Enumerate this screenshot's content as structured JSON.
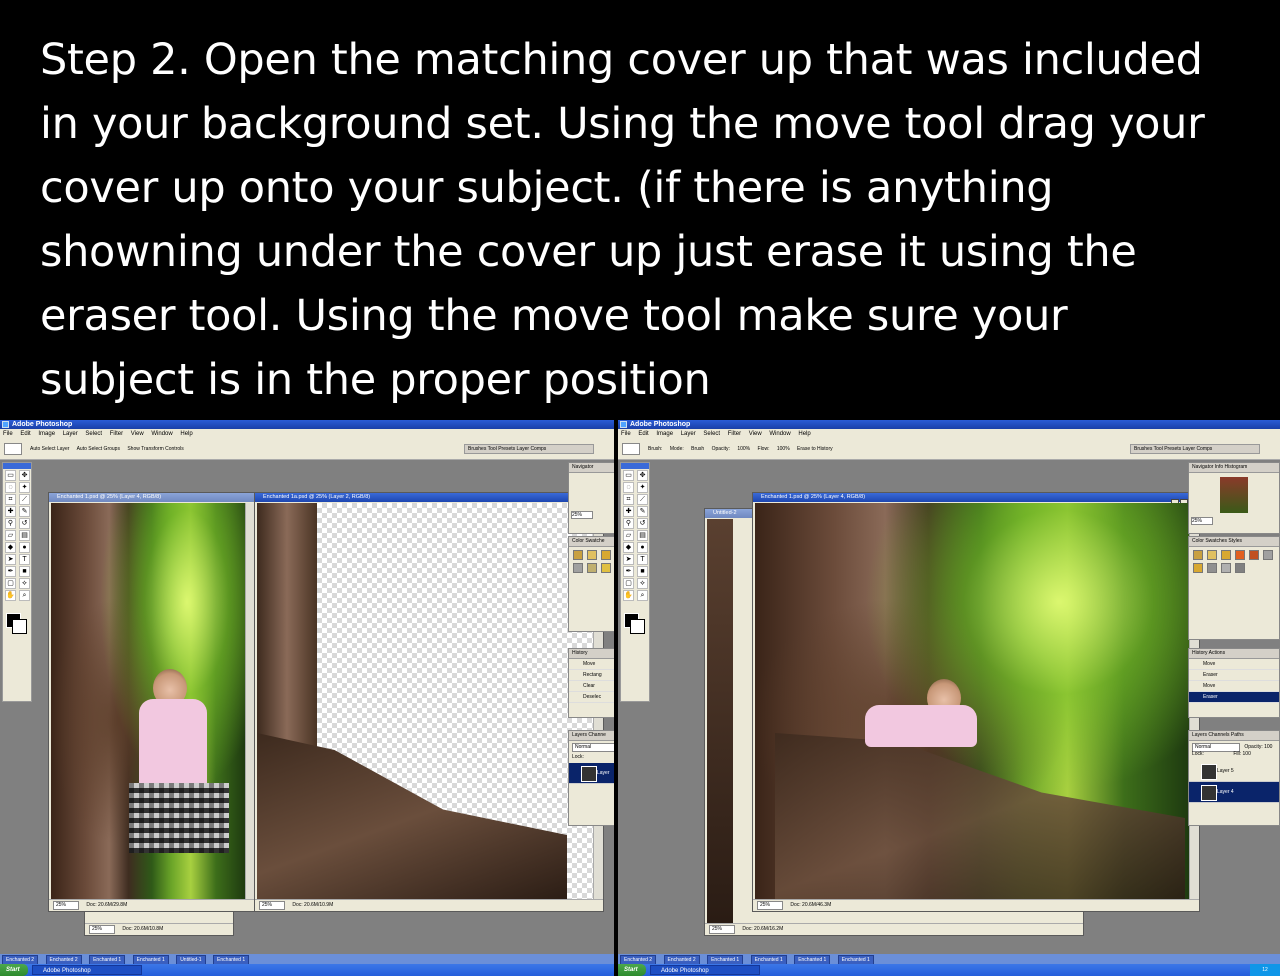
{
  "caption": {
    "lines": [
      "Step 2. Open the matching cover up that was included",
      "in your background set. Using the move tool drag your",
      "cover up onto your subject. (if there is anything",
      "showning under the cover up just erase it using the",
      "eraser tool. Using the move tool make sure your",
      "subject is in the proper position"
    ]
  },
  "left": {
    "app_title": "Adobe Photoshop",
    "menu": [
      "File",
      "Edit",
      "Image",
      "Layer",
      "Select",
      "Filter",
      "View",
      "Window",
      "Help"
    ],
    "options": [
      "Auto Select Layer",
      "Auto Select Groups",
      "Show Transform Controls"
    ],
    "dock_tabs": "Brushes  Tool Presets  Layer Comps",
    "doc1": {
      "title": "Enchanted 1.psd @ 25% (Layer 4, RGB/8)",
      "zoom": "25%",
      "doc": "Doc: 20.6M/29.8M"
    },
    "doc2": {
      "title": "Enchanted 1a.psd @ 25% (Layer 2, RGB/8)",
      "zoom": "25%",
      "doc": "Doc: 20.6M/10.9M"
    },
    "doc_back": {
      "zoom": "25%",
      "doc": "Doc: 20.6M/10.8M"
    },
    "navigator": {
      "tab": "Navigator",
      "zoom": "25%"
    },
    "color_tabs": "Color  Swatche",
    "history": {
      "tab": "History",
      "items": [
        "Move",
        "Rectang",
        "Clear",
        "Deselec"
      ]
    },
    "layers": {
      "tab": "Layers  Channe",
      "blend": "Normal",
      "lock": "Lock:",
      "layer": "Layer"
    },
    "tasks": [
      "Enchanted 2",
      "Enchanted 2",
      "Enchanted 1",
      "Enchanted 1",
      "Untitled-1",
      "Enchanted 1"
    ]
  },
  "right": {
    "app_title": "Adobe Photoshop",
    "menu": [
      "File",
      "Edit",
      "Image",
      "Layer",
      "Select",
      "Filter",
      "View",
      "Window",
      "Help"
    ],
    "options": [
      "Brush:",
      "Mode:",
      "Brush",
      "Opacity:",
      "100%",
      "Flow:",
      "100%",
      "Erase to History"
    ],
    "dock_tabs": "Brushes  Tool Presets  Layer Comps",
    "doc_main": {
      "title": "Enchanted 1.psd @ 25% (Layer 4, RGB/8)",
      "zoom": "25%",
      "doc": "Doc: 20.6M/46.3M"
    },
    "doc_back_title": "Untitled-2",
    "doc_back": {
      "zoom": "25%",
      "doc": "Doc: 20.6M/16.2M"
    },
    "navigator": {
      "tab": "Navigator  Info  Histogram",
      "zoom": "25%"
    },
    "color_tabs": "Color  Swatches  Styles",
    "history": {
      "tab": "History  Actions",
      "items": [
        "Move",
        "Eraser",
        "Move",
        "Eraser"
      ]
    },
    "layers": {
      "tab": "Layers  Channels  Paths",
      "blend": "Normal",
      "opacity": "Opacity: 100",
      "lock": "Lock:",
      "fill": "Fill: 100",
      "layer5": "Layer 5",
      "layer4": "Layer 4"
    },
    "tasks": [
      "Enchanted 2",
      "Enchanted 2",
      "Enchanted 1",
      "Enchanted 1",
      "Enchanted 1",
      "Enchanted 1"
    ]
  },
  "taskbar": {
    "start": "Start",
    "task": "Adobe Photoshop",
    "clock": "12"
  }
}
